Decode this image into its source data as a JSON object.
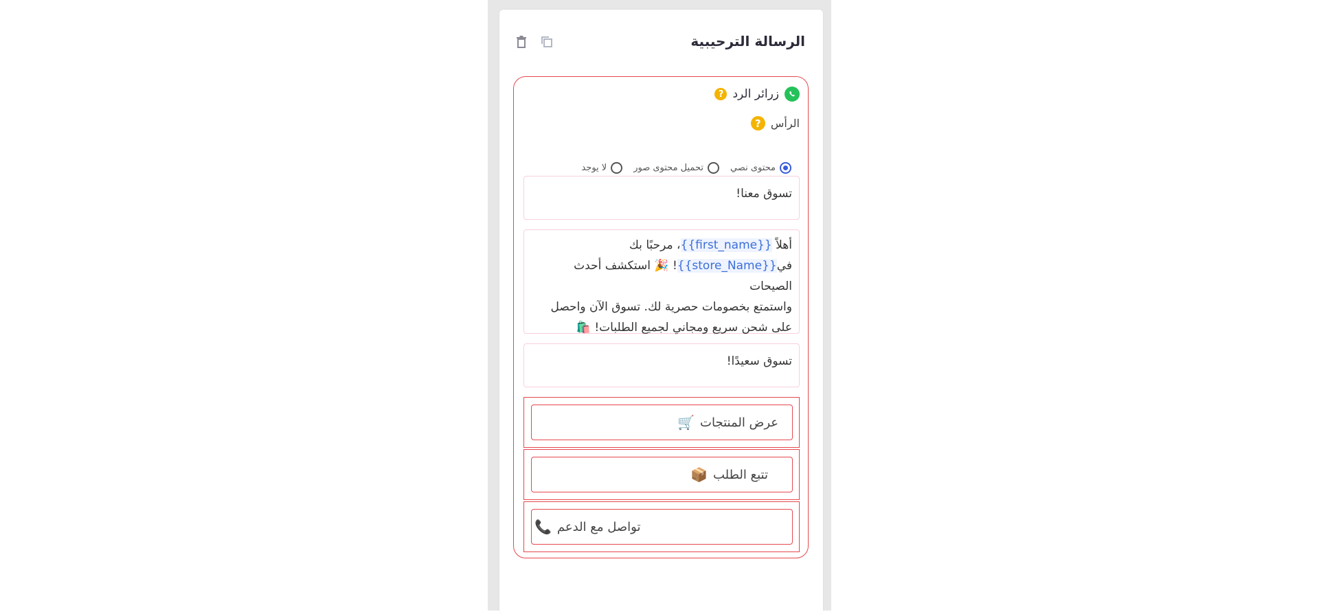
{
  "card": {
    "title": "الرسالة الترحيبية"
  },
  "reply_section": {
    "title": "زرائر الرد",
    "header_label": "الرأس"
  },
  "header_type": {
    "options": [
      "محتوى نصي",
      "تحميل محتوى صور",
      "لا يوجد"
    ],
    "selected": "محتوى نصي"
  },
  "message": {
    "header_text": "تسوق معنا!",
    "body": {
      "line1_prefix": "أهلاً ",
      "var_first_name": "{{first_name}}",
      "line1_suffix": "، مرحبًا بك",
      "line2_prefix": "في",
      "var_store_name": "{{store_Name}}",
      "line2_suffix": "! 🎉 استكشف أحدث الصيحات",
      "line3": "واستمتع بخصومات حصرية لك. تسوق الآن واحصل",
      "line4": "على شحن سريع ومجاني لجميع الطلبات! 🛍️"
    },
    "footer_text": "تسوق سعيدًا!"
  },
  "buttons": [
    {
      "label": "عرض المنتجات",
      "emoji": "🛒"
    },
    {
      "label": "تتبع الطلب",
      "emoji": "📦"
    },
    {
      "label": "تواصل مع الدعم",
      "emoji": "📞"
    }
  ],
  "colors": {
    "accent_border": "#e5484d",
    "radio_selected": "#3b5bdb",
    "help_icon": "#f4b400",
    "whatsapp": "#25c15a"
  }
}
